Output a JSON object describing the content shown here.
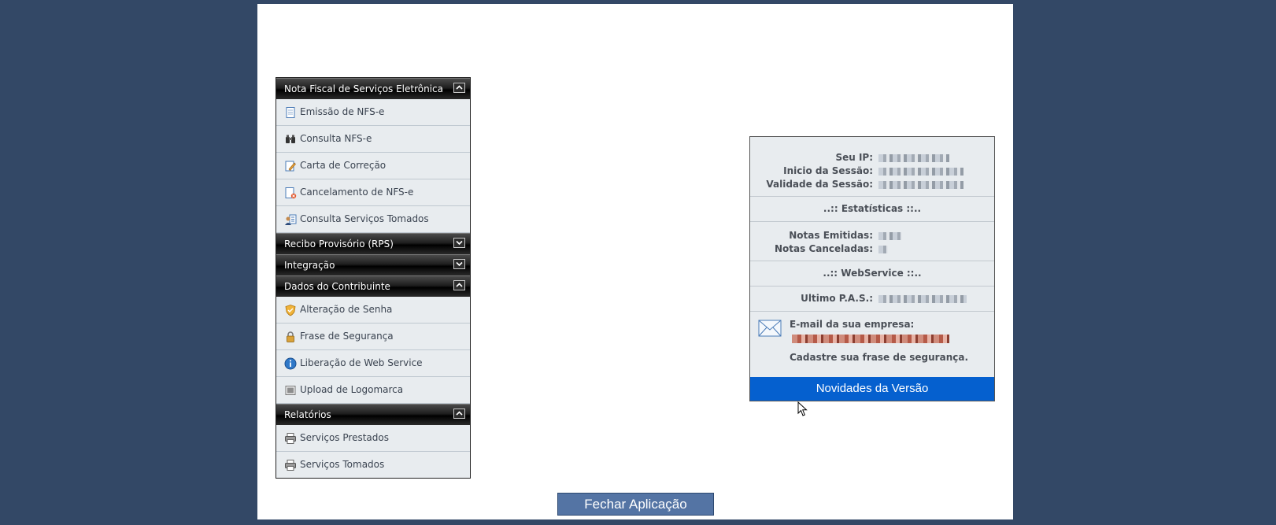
{
  "menu": {
    "sections": [
      {
        "title": "Nota Fiscal de Serviços Eletrônica",
        "expanded": true,
        "items": [
          {
            "label": "Emissão de NFS-e",
            "icon": "document-icon"
          },
          {
            "label": "Consulta NFS-e",
            "icon": "binoculars-icon"
          },
          {
            "label": "Carta de Correção",
            "icon": "edit-document-icon"
          },
          {
            "label": "Cancelamento de NFS-e",
            "icon": "cancel-document-icon"
          },
          {
            "label": "Consulta Serviços Tomados",
            "icon": "user-list-icon"
          }
        ]
      },
      {
        "title": "Recibo Provisório (RPS)",
        "expanded": false,
        "items": []
      },
      {
        "title": "Integração",
        "expanded": false,
        "items": []
      },
      {
        "title": "Dados do Contribuinte",
        "expanded": true,
        "items": [
          {
            "label": "Alteração de Senha",
            "icon": "shield-icon"
          },
          {
            "label": "Frase de Segurança",
            "icon": "lock-icon"
          },
          {
            "label": "Liberação de Web Service",
            "icon": "info-icon"
          },
          {
            "label": "Upload de Logomarca",
            "icon": "image-icon"
          }
        ]
      },
      {
        "title": "Relatórios",
        "expanded": true,
        "items": [
          {
            "label": "Serviços Prestados",
            "icon": "printer-icon"
          },
          {
            "label": "Serviços Tomados",
            "icon": "printer-icon"
          }
        ]
      }
    ]
  },
  "info": {
    "session": {
      "ip_label": "Seu IP:",
      "start_label": "Inicio da Sessão:",
      "validity_label": "Validade da Sessão:"
    },
    "stats_title": "..:: Estatísticas ::..",
    "stats": {
      "issued_label": "Notas Emitidas:",
      "cancelled_label": "Notas Canceladas:"
    },
    "webservice_title": "..:: WebService ::..",
    "last_pas_label": "Ultimo P.A.S.:",
    "email_label": "E-mail da sua empresa:",
    "email_hint": "Cadastre sua frase de segurança.",
    "news_button": "Novidades da Versão"
  },
  "close_button": "Fechar Aplicação",
  "colors": {
    "background": "#334866",
    "accent_blue": "#0560cf",
    "close_button": "#5474a4"
  }
}
